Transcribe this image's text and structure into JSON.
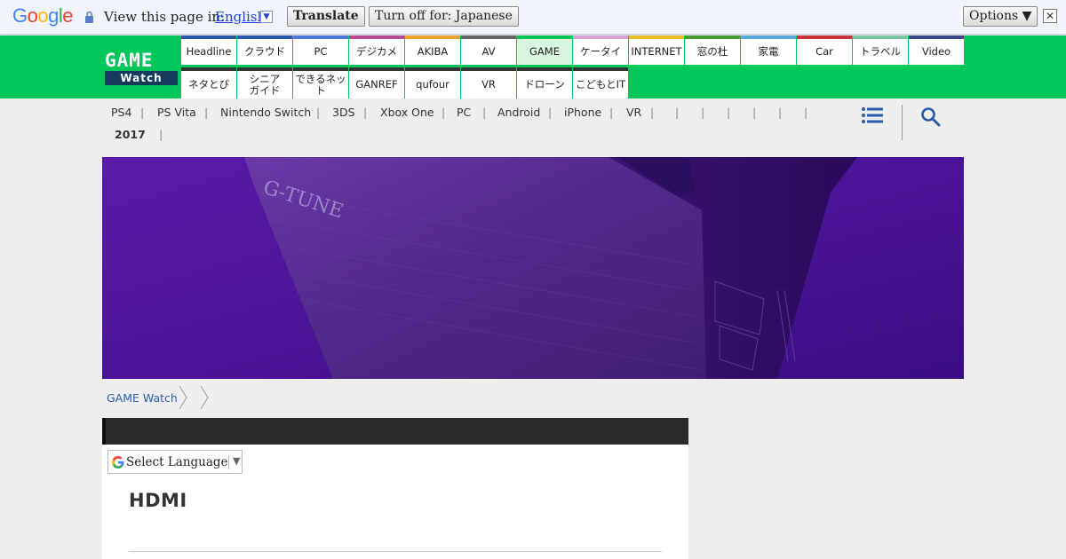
{
  "translate_bar": {
    "logo": [
      "G",
      "o",
      "o",
      "g",
      "l",
      "e"
    ],
    "logo_colors": [
      "#4285f4",
      "#ea4335",
      "#fbbc05",
      "#4285f4",
      "#34a853",
      "#ea4335"
    ],
    "prompt": "View this page in:",
    "language": "English",
    "translate_button": "Translate",
    "turn_off_button": "Turn off for: Japanese",
    "options_button": "Options ▼",
    "close_glyph": "✕"
  },
  "header": {
    "logo_top": "GAME",
    "logo_bottom": "Watch",
    "nav_row1": [
      {
        "label": "Headline",
        "color": "#2f57a8"
      },
      {
        "label": "クラウド",
        "color": "#2f57a8"
      },
      {
        "label": "PC",
        "color": "#4a77d9"
      },
      {
        "label": "デジカメ",
        "color": "#b44a92"
      },
      {
        "label": "AKIBA",
        "color": "#f0a132"
      },
      {
        "label": "AV",
        "color": "#666666"
      },
      {
        "label": "GAME",
        "color": "#00c75a",
        "active": true
      },
      {
        "label": "ケータイ",
        "color": "#d6a3d6"
      },
      {
        "label": "INTERNET",
        "color": "#e8c02c"
      },
      {
        "label": "窓の杜",
        "color": "#4a9b2f"
      },
      {
        "label": "家電",
        "color": "#58a9dc"
      },
      {
        "label": "Car",
        "color": "#c9343a"
      },
      {
        "label": "トラベル",
        "color": "#7cc8a0"
      },
      {
        "label": "Video",
        "color": "#3a4a8a"
      }
    ],
    "nav_row2": [
      {
        "label": "ネタとぴ",
        "color": "#333333"
      },
      {
        "label": "シニア\nガイド",
        "color": "#333333"
      },
      {
        "label": "できるネット",
        "color": "#333333"
      },
      {
        "label": "GANREF",
        "color": "#333333"
      },
      {
        "label": "qufour",
        "color": "#333333"
      },
      {
        "label": "VR",
        "color": "#333333"
      },
      {
        "label": "ドローン",
        "color": "#333333"
      },
      {
        "label": "こどもとIT",
        "color": "#333333"
      }
    ]
  },
  "subnav": {
    "items": [
      "PS4",
      "PS Vita",
      "Nintendo Switch",
      "3DS",
      "Xbox One",
      "PC",
      "Android",
      "iPhone",
      "VR",
      "",
      "",
      "",
      "",
      "",
      ""
    ],
    "year": "2017",
    "menu_icon": "list-icon",
    "search_icon": "search-icon"
  },
  "banner": {
    "brand_text": "G-TUNE",
    "accent": "#4a1396"
  },
  "breadcrumb": {
    "home": "GAME Watch"
  },
  "article": {
    "language_select": "Select Language",
    "title": "HDMI"
  }
}
